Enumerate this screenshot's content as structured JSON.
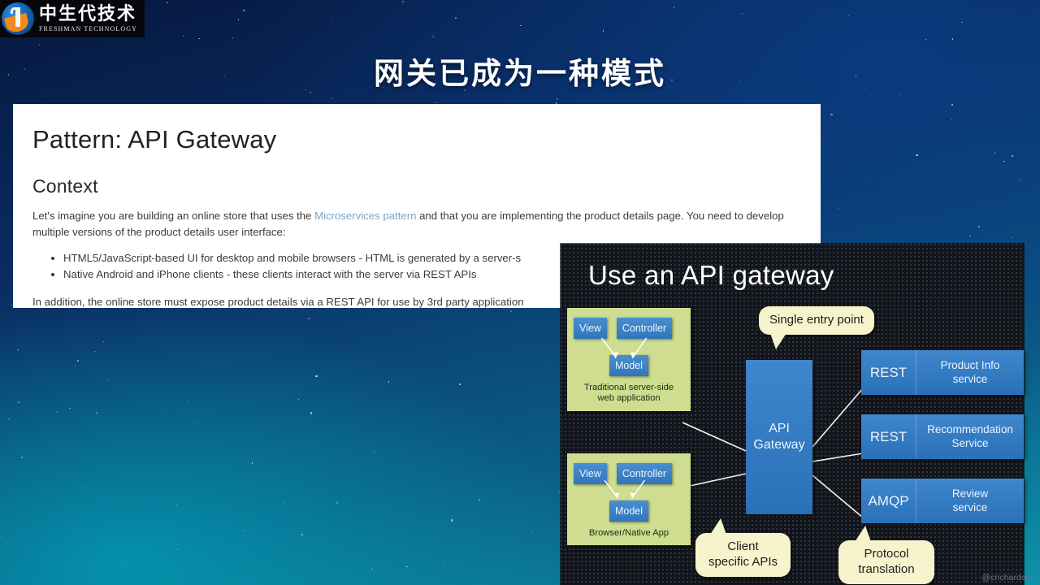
{
  "logo": {
    "cn_name": "中生代技术",
    "en_name": "FRESHMAN TECHNOLOGY",
    "icon": "freshman-technology-logo-icon"
  },
  "slide": {
    "title": "网关已成为一种模式"
  },
  "document": {
    "heading": "Pattern: API Gateway",
    "subheading": "Context",
    "paragraph_before_link": "Let's imagine you are building an online store that uses the ",
    "link_text": "Microservices pattern",
    "paragraph_after_link": " and that you are implementing the product details page. You need to develop multiple versions of the product details user interface:",
    "bullets": [
      "HTML5/JavaScript-based UI for desktop and mobile browsers - HTML is generated by a server-s",
      "Native Android and iPhone clients - these clients interact with the server via REST APIs"
    ],
    "closing_paragraph": "In addition, the online store must expose product details via a REST API for use by 3rd party application"
  },
  "diagram": {
    "title": "Use an API gateway",
    "gateway": {
      "label": "API\nGateway",
      "line1": "API",
      "line2": "Gateway"
    },
    "clients": [
      {
        "view": "View",
        "controller": "Controller",
        "model": "Model",
        "caption_line1": "Traditional server-side",
        "caption_line2": "web application"
      },
      {
        "view": "View",
        "controller": "Controller",
        "model": "Model",
        "caption_line1": "Browser/Native App",
        "caption_line2": ""
      }
    ],
    "services": [
      {
        "protocol": "REST",
        "name_line1": "Product Info",
        "name_line2": "service"
      },
      {
        "protocol": "REST",
        "name_line1": "Recommendation",
        "name_line2": "Service"
      },
      {
        "protocol": "AMQP",
        "name_line1": "Review",
        "name_line2": "service"
      }
    ],
    "callouts": [
      {
        "line1": "Single entry point",
        "line2": ""
      },
      {
        "line1": "Client",
        "line2": "specific APIs"
      },
      {
        "line1": "Protocol",
        "line2": "translation"
      }
    ],
    "watermark": "@crichardson"
  },
  "colors": {
    "accent_blue": "#2f76bb",
    "client_green": "#cedd8f",
    "callout_yellow": "#f7f4cd",
    "panel_white": "#ffffff",
    "link_blue": "#7aa7c7"
  }
}
